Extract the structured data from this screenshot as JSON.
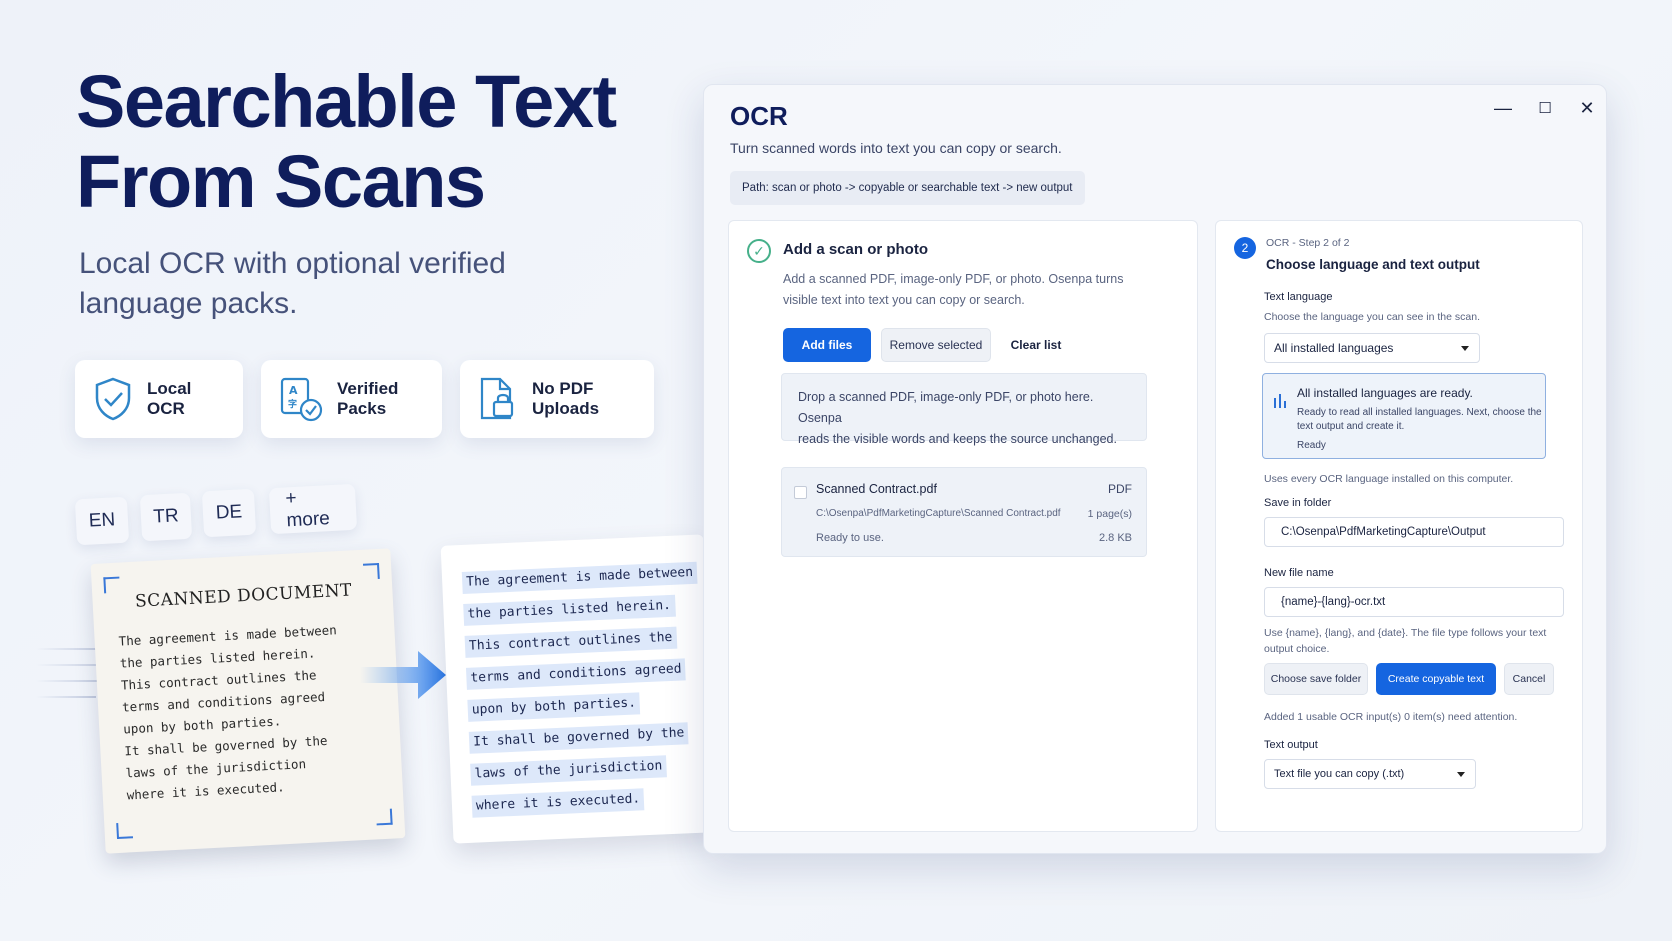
{
  "hero": {
    "title_line1": "Searchable Text",
    "title_line2": "From Scans",
    "subtitle": "Local OCR with optional verified language packs."
  },
  "features": [
    {
      "label": "Local OCR",
      "icon": "shield-check-icon"
    },
    {
      "label": "Verified Packs",
      "icon": "language-doc-check-icon"
    },
    {
      "label": "No PDF Uploads",
      "icon": "doc-lock-icon"
    }
  ],
  "languages": [
    "EN",
    "TR",
    "DE",
    "+ more"
  ],
  "scanned_doc": {
    "title": "SCANNED DOCUMENT",
    "lines": [
      "The agreement is made between",
      "the parties listed herein.",
      "This contract outlines the",
      "terms and conditions agreed",
      "upon by both parties.",
      "It shall be governed by the",
      "laws of the jurisdiction",
      "where it is executed."
    ]
  },
  "window": {
    "title": "OCR",
    "subtitle": "Turn scanned words into text you can copy or search.",
    "path": "Path: scan or photo -> copyable or searchable text -> new output",
    "controls": {
      "minimize": "—",
      "maximize": "☐",
      "close": "✕"
    }
  },
  "step1": {
    "title": "Add a scan or photo",
    "description_line1": "Add a scanned PDF, image-only PDF, or photo. Osenpa turns",
    "description_line2": "visible text into text you can copy or search.",
    "add_files": "Add files",
    "remove_selected": "Remove selected",
    "clear_list": "Clear list",
    "dropzone_line1": "Drop a scanned PDF, image-only PDF, or photo here. Osenpa",
    "dropzone_line2": "reads the visible words and keeps the source unchanged.",
    "file": {
      "name": "Scanned Contract.pdf",
      "type": "PDF",
      "path": "C:\\Osenpa\\PdfMarketingCapture\\Scanned Contract.pdf",
      "pages": "1 page(s)",
      "status": "Ready to use.",
      "size": "2.8 KB"
    }
  },
  "step2": {
    "badge": "2",
    "kicker": "OCR - Step 2 of 2",
    "title": "Choose language and text output",
    "text_language_label": "Text language",
    "text_language_hint": "Choose the language you can see in the scan.",
    "language_value": "All installed languages",
    "info_title": "All installed languages are ready.",
    "info_line1": "Ready to read all installed languages. Next, choose the",
    "info_line2": "text output and create it.",
    "info_status": "Ready",
    "uses_note": "Uses every OCR language installed on this computer.",
    "save_folder_label": "Save in folder",
    "save_folder_value": "C:\\Osenpa\\PdfMarketingCapture\\Output",
    "file_name_label": "New file name",
    "file_name_value": "{name}-{lang}-ocr.txt",
    "file_name_hint_line1": "Use {name}, {lang}, and {date}. The file type follows your text",
    "file_name_hint_line2": "output choice.",
    "choose_folder": "Choose save folder",
    "create": "Create copyable text",
    "cancel": "Cancel",
    "added_note": "Added 1 usable OCR input(s) 0 item(s) need attention.",
    "text_output_label": "Text output",
    "text_output_value": "Text file you can copy (.txt)"
  },
  "colors": {
    "accent": "#1565e0",
    "heading": "#0f1d5c",
    "success": "#46b08a"
  }
}
